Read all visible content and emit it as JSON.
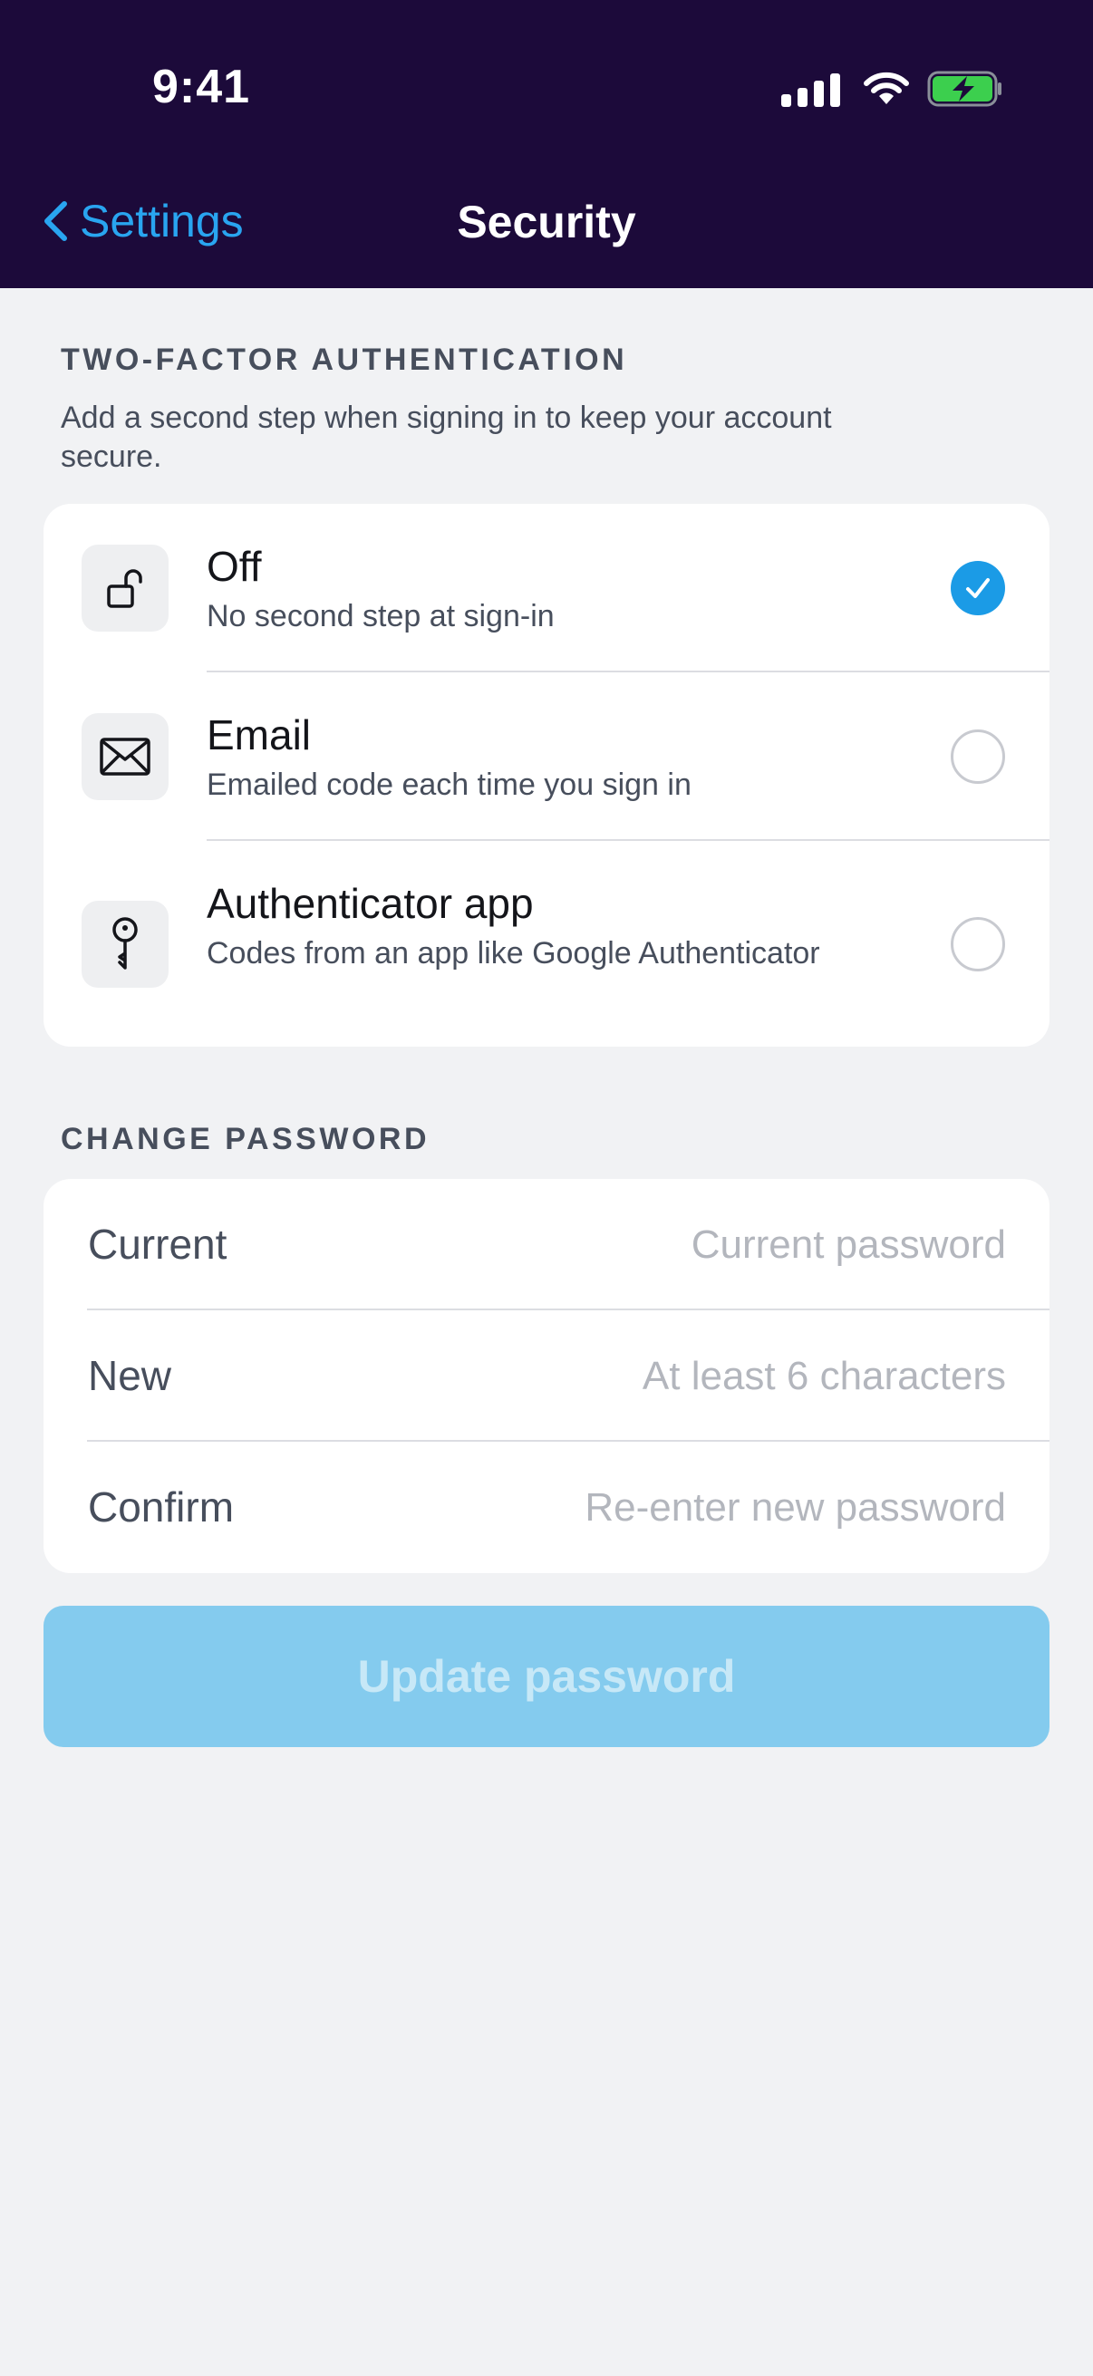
{
  "status_bar": {
    "time": "9:41",
    "icons": [
      "cellular-signal-icon",
      "wifi-icon",
      "battery-charging-icon"
    ],
    "battery_color": "#3ccf4e"
  },
  "nav": {
    "back_label": "Settings",
    "title": "Security",
    "accent": "#29a5f0",
    "background": "#1c0a3a"
  },
  "two_factor": {
    "title": "TWO-FACTOR AUTHENTICATION",
    "description": "Add a second step when signing in to keep your account secure.",
    "options": [
      {
        "label": "Off",
        "sub": "No second step at sign-in",
        "icon": "unlock-icon",
        "selected": true
      },
      {
        "label": "Email",
        "sub": "Emailed code each time you sign in",
        "icon": "envelope-icon",
        "selected": false
      },
      {
        "label": "Authenticator app",
        "sub": "Codes from an app like Google Authenticator",
        "icon": "key-icon",
        "selected": false
      }
    ],
    "selected_color": "#1b9be6"
  },
  "change_password": {
    "title": "CHANGE PASSWORD",
    "fields": [
      {
        "label": "Current",
        "value": "",
        "placeholder": "Current password"
      },
      {
        "label": "New",
        "value": "",
        "placeholder": "At least 6 characters"
      },
      {
        "label": "Confirm",
        "value": "",
        "placeholder": "Re-enter new password"
      }
    ],
    "submit_label": "Update password",
    "submit_state": "disabled",
    "submit_color": "#84cbee"
  }
}
